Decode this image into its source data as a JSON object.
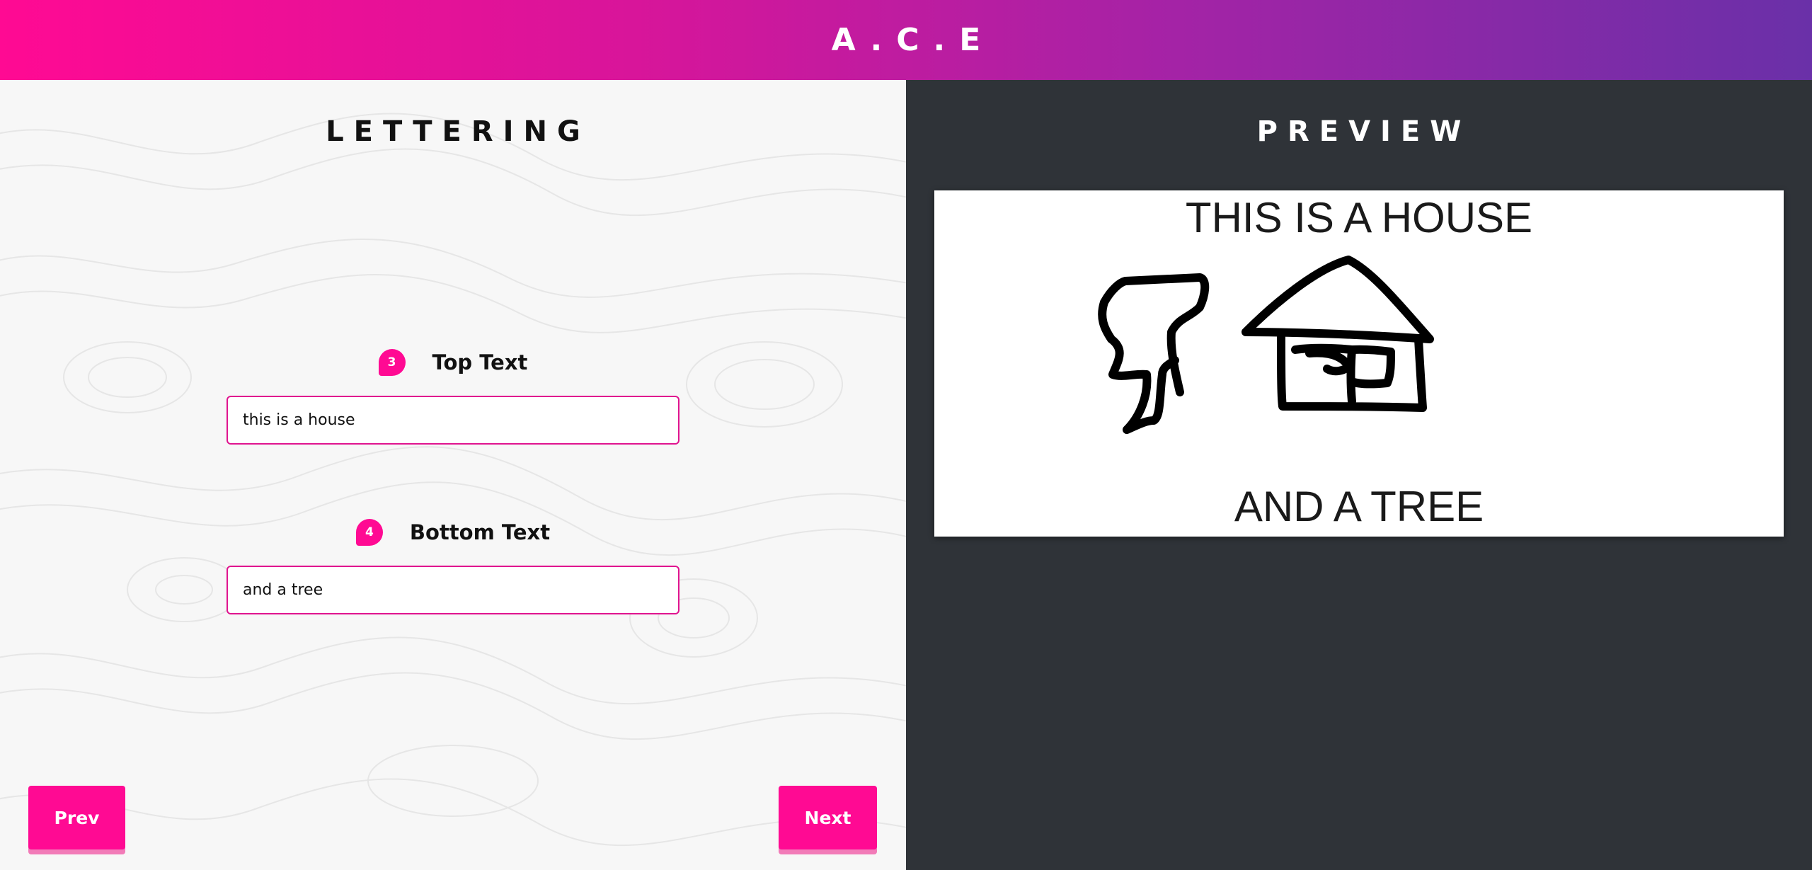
{
  "header": {
    "title": "A.C.E"
  },
  "editor": {
    "heading": "LETTERING",
    "fields": [
      {
        "step": "3",
        "label": "Top Text",
        "value": "this is a house"
      },
      {
        "step": "4",
        "label": "Bottom Text",
        "value": "and a tree"
      }
    ],
    "prev_label": "Prev",
    "next_label": "Next"
  },
  "preview": {
    "heading": "PREVIEW",
    "top_caption": "THIS IS A HOUSE",
    "bottom_caption": "AND A TREE",
    "drawing": "hand-drawn-tree-and-house"
  },
  "colors": {
    "accent": "#ff0a93",
    "header_gradient_start": "#ff0a93",
    "header_gradient_end": "#6a30a8",
    "dark_panel": "#2f3338"
  }
}
